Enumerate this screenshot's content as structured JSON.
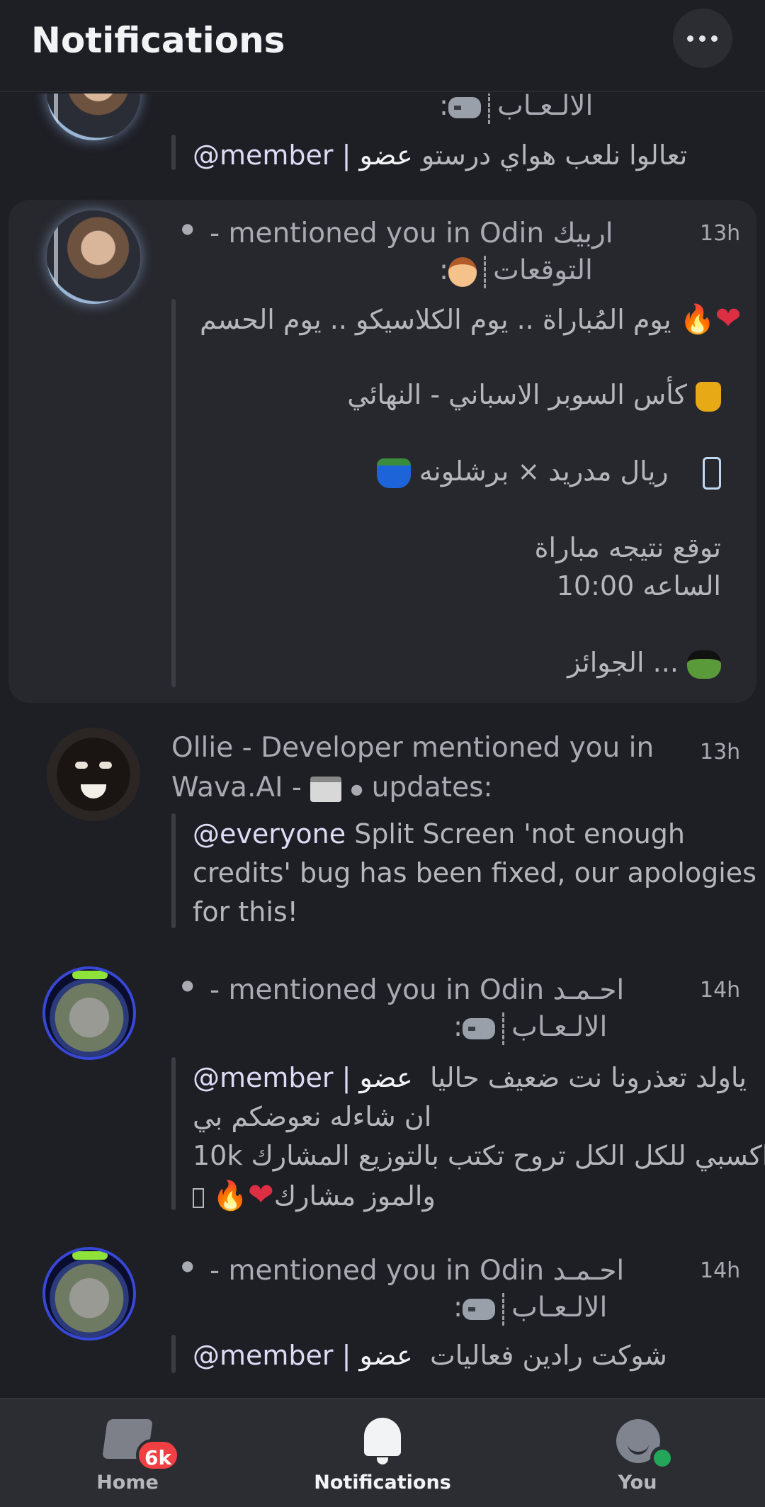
{
  "header": {
    "title": "Notifications",
    "more_icon": "more-horizontal-icon"
  },
  "notifications": [
    {
      "channel_line": "الالـعـاب",
      "quote": {
        "tag": "عضو",
        "text": "تعالوا نلعب هواي درستو",
        "mention": "@member |"
      }
    },
    {
      "title_line1": "اربيك",
      "title_mid": "- mentioned you in Odin",
      "channel_line": "التوقعات",
      "time": "13h",
      "lines": [
        "يوم المُباراة .. يوم الكلاسيكو .. يوم الحسم",
        "كأس السوبر الاسباني - النهائي",
        "ريال مدريد × برشلونه",
        "توقع نتيجه مباراة",
        "الساعه 10:00",
        "الجوائز ..."
      ]
    },
    {
      "title_line1": "Ollie - Developer mentioned you in",
      "title_line2": "Wava.AI -",
      "title_tail": "updates:",
      "time": "13h",
      "quote": {
        "mention": "@everyone",
        "line1": "Split Screen 'not enough",
        "line2": "credits' bug has been fixed, our apologies",
        "line3": "for this!"
      }
    },
    {
      "title_name": "احـمـد",
      "title_mid": "- mentioned you in Odin",
      "channel_line": "الالـعـاب",
      "time": "14h",
      "quote": {
        "tag": "عضو",
        "text": "ياولد تعذرونا نت ضعيف حاليا",
        "mention": "@member |",
        "line2": "ان شاءله نعوضكم بي",
        "line3_prefix": "10k",
        "line3": "اكسبي للكل الكل تروح تكتب بالتوزيع المشارك",
        "line4": "والموز مشارك"
      }
    },
    {
      "title_name": "احـمـد",
      "title_mid": "- mentioned you in Odin",
      "channel_line": "الالـعـاب",
      "time": "14h",
      "quote": {
        "tag": "عضو",
        "text": "شوكت رادين فعاليات",
        "mention": "@member |"
      }
    }
  ],
  "bottom_nav": {
    "home": {
      "label": "Home",
      "badge": "6k",
      "icon": "home-icon"
    },
    "notifications": {
      "label": "Notifications",
      "icon": "bell-icon"
    },
    "you": {
      "label": "You",
      "icon": "avatar-icon"
    },
    "colors": {
      "active": "#f2f3f5",
      "inactive": "#b5b7bd",
      "badge": "#f23f43",
      "online": "#23a55a"
    }
  }
}
